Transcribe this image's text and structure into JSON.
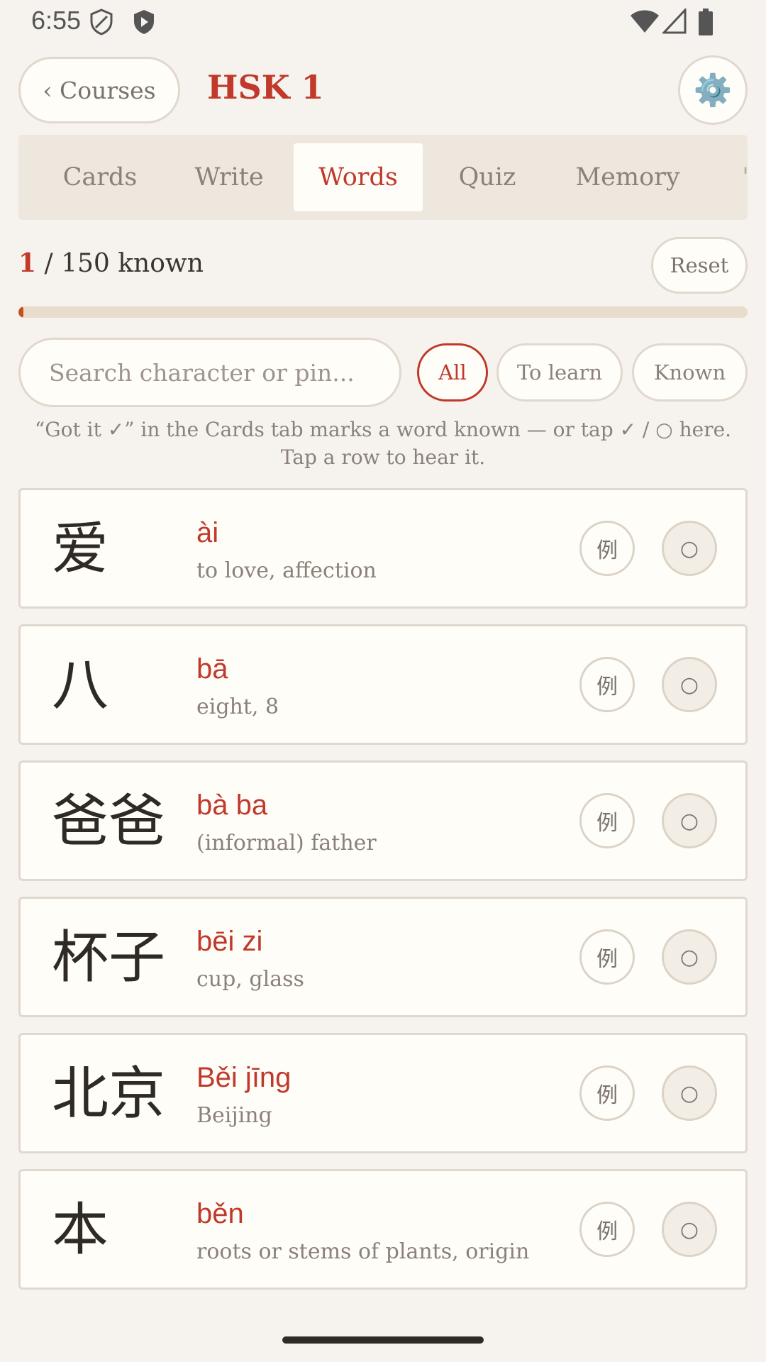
{
  "status": {
    "time": "6:55"
  },
  "header": {
    "back_label": "‹ Courses",
    "title": "HSK 1",
    "settings_icon": "gear-icon"
  },
  "tabs": [
    {
      "label": "Cards",
      "active": false
    },
    {
      "label": "Write",
      "active": false
    },
    {
      "label": "Words",
      "active": true
    },
    {
      "label": "Quiz",
      "active": false
    },
    {
      "label": "Memory",
      "active": false
    }
  ],
  "progress": {
    "known": "1",
    "text": " / 150 known",
    "fraction": 0.0067,
    "reset_label": "Reset"
  },
  "search": {
    "placeholder": "Search character or pin..."
  },
  "filters": [
    {
      "label": "All",
      "active": true
    },
    {
      "label": "To learn",
      "active": false
    },
    {
      "label": "Known",
      "active": false
    }
  ],
  "hint": "“Got it ✓” in the Cards tab marks a word known — or tap ✓ / ○ here. Tap a row to hear it.",
  "words": [
    {
      "hanzi": "爱",
      "pinyin": "ài",
      "meaning": "to love, affection",
      "example_label": "例",
      "known_label": "○"
    },
    {
      "hanzi": "八",
      "pinyin": "bā",
      "meaning": "eight, 8",
      "example_label": "例",
      "known_label": "○"
    },
    {
      "hanzi": "爸爸",
      "pinyin": "bà ba",
      "meaning": "(informal) father",
      "example_label": "例",
      "known_label": "○"
    },
    {
      "hanzi": "杯子",
      "pinyin": "bēi zi",
      "meaning": "cup, glass",
      "example_label": "例",
      "known_label": "○"
    },
    {
      "hanzi": "北京",
      "pinyin": "Běi jīng",
      "meaning": "Beijing",
      "example_label": "例",
      "known_label": "○"
    },
    {
      "hanzi": "本",
      "pinyin": "běn",
      "meaning": "roots or stems of plants, origin",
      "example_label": "例",
      "known_label": "○"
    }
  ]
}
